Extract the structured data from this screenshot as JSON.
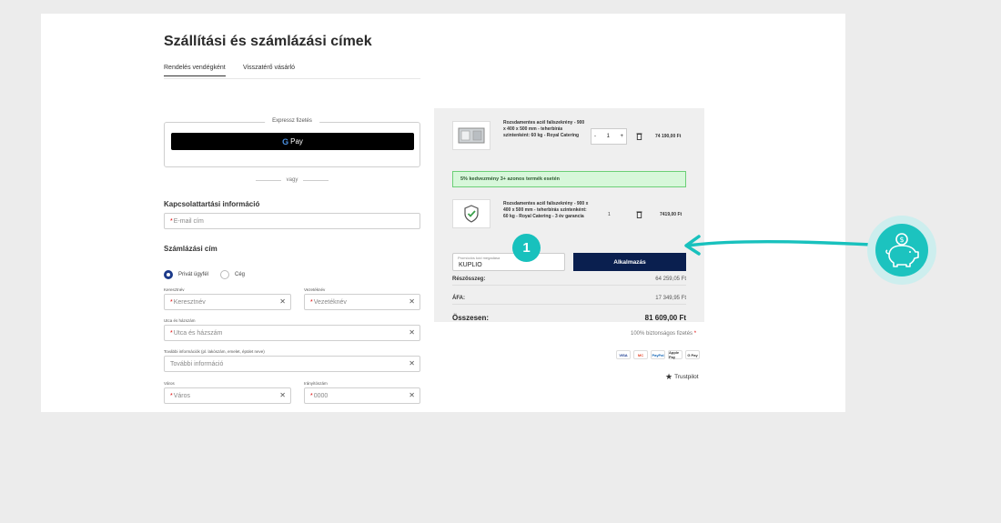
{
  "page": {
    "title": "Szállítási és számlázási címek",
    "tabs": [
      {
        "label": "Rendelés vendégként",
        "active": true
      },
      {
        "label": "Visszatérő vásárló",
        "active": false
      }
    ]
  },
  "express": {
    "label": "Expressz fizetés",
    "gpay_g": "G",
    "gpay_text": "Pay",
    "or_text": "vagy"
  },
  "contact": {
    "heading": "Kapcsolattartási információ",
    "email_placeholder": "E-mail cím"
  },
  "billing": {
    "heading": "Számlázási cím",
    "radio_private": "Privát ügyfél",
    "radio_company": "Cég",
    "firstname_label": "Keresztnév",
    "firstname_placeholder": "Keresztnév",
    "lastname_label": "Vezetéknév",
    "lastname_placeholder": "Vezetéknév",
    "street_label": "Utca és házszám",
    "street_placeholder": "Utca és házszám",
    "extra_label": "További információk (pl. lakószám, emelet, épület neve)",
    "extra_placeholder": "További információ",
    "city_label": "Város",
    "city_placeholder": "Város",
    "zip_label": "Irányítószám",
    "zip_placeholder": "0000",
    "required_mark": "*",
    "clear_glyph": "✕"
  },
  "cart": {
    "items": [
      {
        "name": "Rozsdamentes acél faliszekrény - 900 x 400 x 500 mm - teherbírás szintenként: 60 kg - Royal Catering",
        "qty": "1",
        "minus": "-",
        "plus": "+",
        "price": "74 190,00 Ft"
      },
      {
        "name": "Rozsdamentes acél faliszekrény - 900 x 400 x 500 mm - teherbírás szintenként: 60 kg - Royal Catering - 3 év garancia",
        "qty": "1",
        "price": "7419,00 Ft"
      }
    ],
    "discount_text": "5% kedvezmény 3+ azonos termék esetén",
    "promo_label": "Promóciós kód megadása",
    "promo_value": "KUPLIO",
    "apply_label": "Alkalmazás",
    "subtotal_label": "Részösszeg:",
    "subtotal_value": "64 259,05 Ft",
    "vat_label": "ÁFA:",
    "vat_value": "17 349,95 Ft",
    "total_label": "Összesen:",
    "total_value": "81 609,00 Ft"
  },
  "footer": {
    "secure_text": "100% biztonságos fizetés",
    "secure_mark": "*",
    "payment_icons": [
      "VISA",
      "MC",
      "PayPal",
      "Apple Pay",
      "G Pay"
    ],
    "trustpilot": "Trustpilot"
  },
  "annotation": {
    "step_number": "1",
    "accent_color": "#18c1bd"
  }
}
